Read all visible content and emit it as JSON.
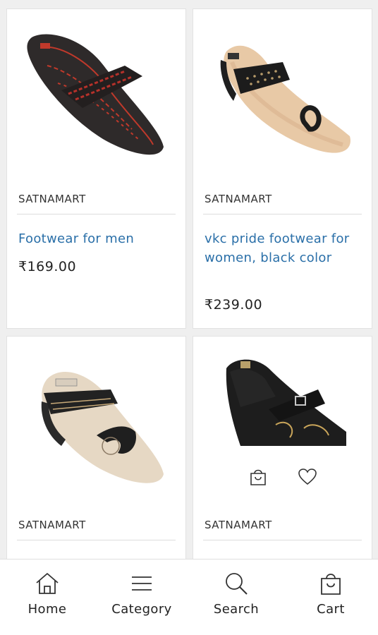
{
  "products": [
    {
      "brand": "SATNAMART",
      "title": "Footwear for men",
      "price": "₹169.00",
      "image": "black-red-flip-flop"
    },
    {
      "brand": "SATNAMART",
      "title": "vkc pride footwear for women, black color",
      "price": "₹239.00",
      "image": "women-black-toe-ring-sandal"
    },
    {
      "brand": "SATNAMART",
      "image": "women-black-strap-sandal-beige"
    },
    {
      "brand": "SATNAMART",
      "image": "women-black-buckle-sandal"
    }
  ],
  "card_actions": {
    "cart_icon": "shopping-bag-icon",
    "wishlist_icon": "heart-icon"
  },
  "nav": {
    "home": "Home",
    "category": "Category",
    "search": "Search",
    "cart": "Cart"
  },
  "colors": {
    "title_link": "#2a6fa8",
    "background": "#efefef",
    "card": "#ffffff"
  }
}
